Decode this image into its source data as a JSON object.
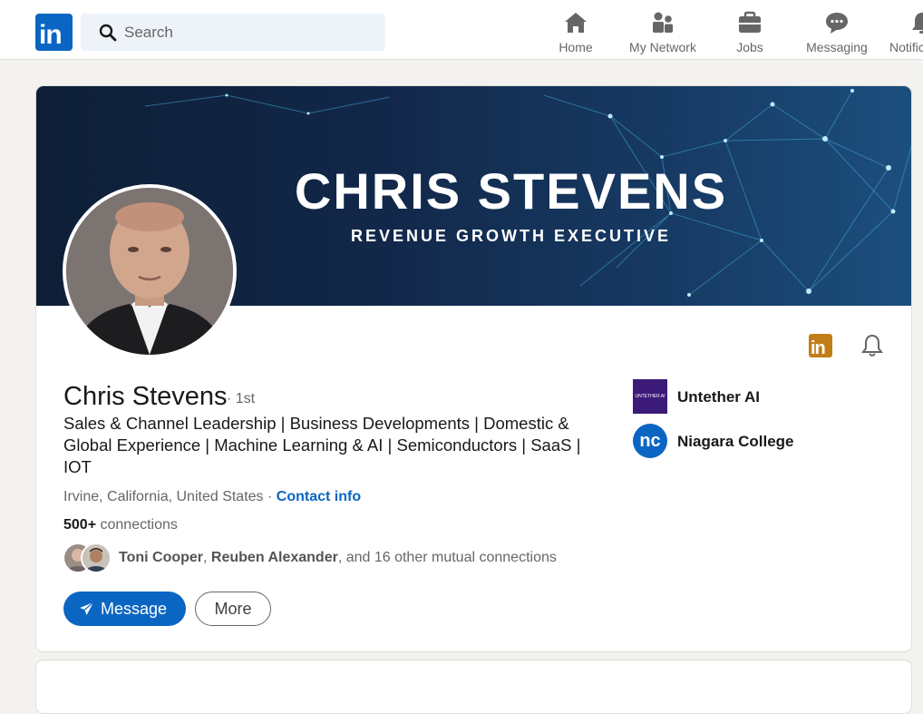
{
  "nav": {
    "search_placeholder": "Search",
    "items": [
      {
        "label": "Home",
        "icon": "home-icon"
      },
      {
        "label": "My Network",
        "icon": "network-icon"
      },
      {
        "label": "Jobs",
        "icon": "jobs-icon"
      },
      {
        "label": "Messaging",
        "icon": "messaging-icon"
      },
      {
        "label": "Notific",
        "icon": "notifications-icon"
      }
    ]
  },
  "banner": {
    "title": "CHRIS STEVENS",
    "subtitle": "REVENUE GROWTH EXECUTIVE"
  },
  "profile": {
    "name": "Chris Stevens",
    "degree": "· 1st",
    "headline": "Sales & Channel Leadership | Business Developments | Domestic & Global Experience | Machine Learning & AI | Semiconductors | SaaS | IOT",
    "location": "Irvine, California, United States",
    "location_sep": " · ",
    "contact_label": "Contact info",
    "connections_count": "500+",
    "connections_label": " connections",
    "mutual": {
      "first": "Toni Cooper",
      "sep": ", ",
      "second": "Reuben Alexander",
      "rest": ", and 16 other mutual connections"
    },
    "message_label": "Message",
    "more_label": "More"
  },
  "organizations": [
    {
      "name": "Untether AI",
      "logo_text": "UNTETHER AI"
    },
    {
      "name": "Niagara College",
      "logo_text": "nc"
    }
  ],
  "colors": {
    "brand": "#0a66c2",
    "premium_badge": "#c37d16",
    "background": "#f3f2ef"
  }
}
